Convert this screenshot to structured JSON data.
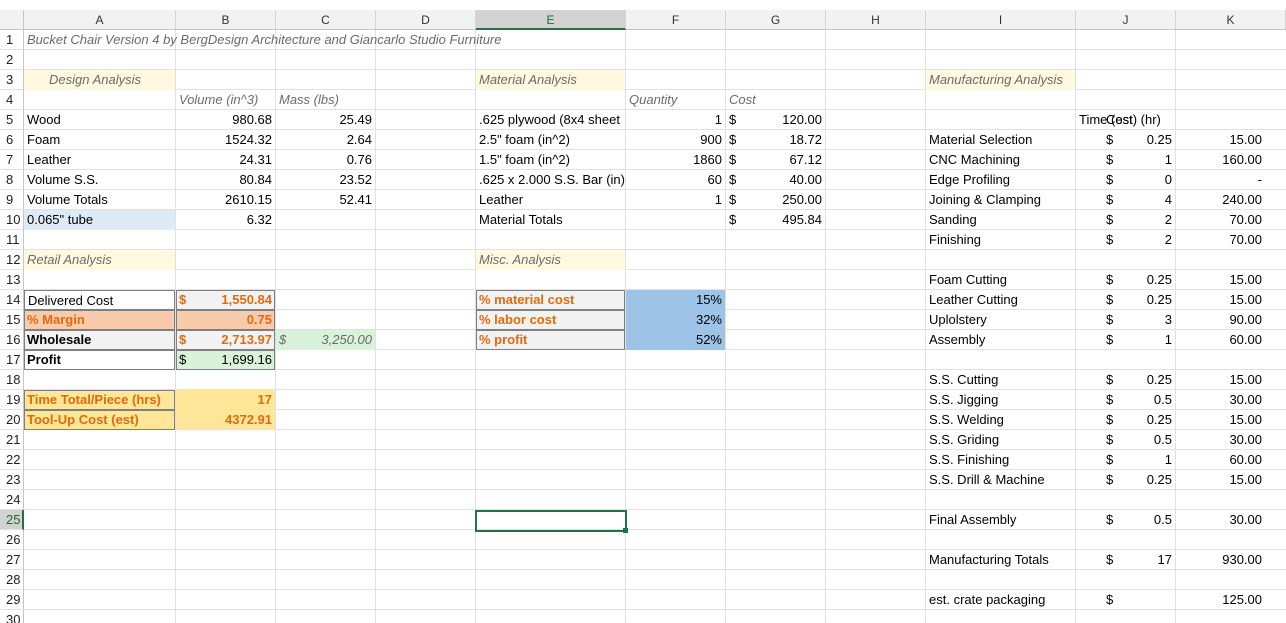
{
  "columns": [
    "A",
    "B",
    "C",
    "D",
    "E",
    "F",
    "G",
    "H",
    "I",
    "J",
    "K"
  ],
  "rows": [
    "1",
    "2",
    "3",
    "4",
    "5",
    "6",
    "7",
    "8",
    "9",
    "10",
    "11",
    "12",
    "13",
    "14",
    "15",
    "16",
    "17",
    "18",
    "19",
    "20",
    "21",
    "22",
    "23",
    "24",
    "25",
    "26",
    "27",
    "28",
    "29",
    "30"
  ],
  "selected_column": "E",
  "selected_row": "25",
  "title": "Bucket Chair Version 4 by BergDesign Architecture and Giancarlo Studio Furniture",
  "design": {
    "header": "Design Analysis",
    "col_volume": "Volume (in^3)",
    "col_mass": "Mass (lbs)",
    "rows": [
      {
        "label": "Wood",
        "volume": "980.68",
        "mass": "25.49"
      },
      {
        "label": "Foam",
        "volume": "1524.32",
        "mass": "2.64"
      },
      {
        "label": "Leather",
        "volume": "24.31",
        "mass": "0.76"
      },
      {
        "label": "Volume S.S.",
        "volume": "80.84",
        "mass": "23.52"
      },
      {
        "label": "Volume Totals",
        "volume": "2610.15",
        "mass": "52.41"
      },
      {
        "label": "0.065\" tube",
        "volume": "6.32",
        "mass": ""
      }
    ]
  },
  "material": {
    "header": "Material Analysis",
    "col_quantity": "Quantity",
    "col_cost": "Cost",
    "rows": [
      {
        "label": ".625 plywood (8x4 sheet",
        "qty": "1",
        "cur": "$",
        "cost": "120.00"
      },
      {
        "label": "2.5\" foam (in^2)",
        "qty": "900",
        "cur": "$",
        "cost": "18.72"
      },
      {
        "label": "1.5\" foam (in^2)",
        "qty": "1860",
        "cur": "$",
        "cost": "67.12"
      },
      {
        "label": ".625 x 2.000 S.S. Bar (in)",
        "qty": "60",
        "cur": "$",
        "cost": "40.00"
      },
      {
        "label": "Leather",
        "qty": "1",
        "cur": "$",
        "cost": "250.00"
      },
      {
        "label": "Material Totals",
        "qty": "",
        "cur": "$",
        "cost": "495.84"
      }
    ]
  },
  "retail": {
    "header": "Retail Analysis",
    "delivered_label": "Delivered Cost",
    "delivered_cur": "$",
    "delivered_value": "1,550.84",
    "margin_label": "% Margin",
    "margin_value": "0.75",
    "wholesale_label": "Wholesale",
    "wholesale_cur": "$",
    "wholesale_value": "2,713.97",
    "wholesale_alt_cur": "$",
    "wholesale_alt_value": "3,250.00",
    "profit_label": "Profit",
    "profit_cur": "$",
    "profit_value": "1,699.16",
    "time_label": "Time Total/Piece (hrs)",
    "time_value": "17",
    "toolup_label": "Tool-Up Cost (est)",
    "toolup_value": "4372.91"
  },
  "misc": {
    "header": "Misc. Analysis",
    "rows": [
      {
        "label": "% material cost",
        "value": "15%"
      },
      {
        "label": "% labor cost",
        "value": "32%"
      },
      {
        "label": "% profit",
        "value": "52%"
      }
    ]
  },
  "manufacturing": {
    "header": "Manufacturing Analysis",
    "col_time": "Time (est) (hr)",
    "col_cost": "Cost",
    "rows": [
      {
        "row": 6,
        "label": "Material Selection",
        "time": "0.25",
        "cur": "$",
        "cost": "15.00"
      },
      {
        "row": 7,
        "label": "CNC Machining",
        "time": "1",
        "cur": "$",
        "cost": "160.00"
      },
      {
        "row": 8,
        "label": "Edge Profiling",
        "time": "0",
        "cur": "$",
        "cost": "-"
      },
      {
        "row": 9,
        "label": "Joining & Clamping",
        "time": "4",
        "cur": "$",
        "cost": "240.00"
      },
      {
        "row": 10,
        "label": "Sanding",
        "time": "2",
        "cur": "$",
        "cost": "70.00"
      },
      {
        "row": 11,
        "label": "Finishing",
        "time": "2",
        "cur": "$",
        "cost": "70.00"
      },
      {
        "row": 13,
        "label": "Foam Cutting",
        "time": "0.25",
        "cur": "$",
        "cost": "15.00"
      },
      {
        "row": 14,
        "label": "Leather Cutting",
        "time": "0.25",
        "cur": "$",
        "cost": "15.00"
      },
      {
        "row": 15,
        "label": "Uplolstery",
        "time": "3",
        "cur": "$",
        "cost": "90.00"
      },
      {
        "row": 16,
        "label": "Assembly",
        "time": "1",
        "cur": "$",
        "cost": "60.00"
      },
      {
        "row": 18,
        "label": "S.S. Cutting",
        "time": "0.25",
        "cur": "$",
        "cost": "15.00"
      },
      {
        "row": 19,
        "label": "S.S. Jigging",
        "time": "0.5",
        "cur": "$",
        "cost": "30.00"
      },
      {
        "row": 20,
        "label": "S.S. Welding",
        "time": "0.25",
        "cur": "$",
        "cost": "15.00"
      },
      {
        "row": 21,
        "label": "S.S. Griding",
        "time": "0.5",
        "cur": "$",
        "cost": "30.00"
      },
      {
        "row": 22,
        "label": "S.S. Finishing",
        "time": "1",
        "cur": "$",
        "cost": "60.00"
      },
      {
        "row": 23,
        "label": "S.S. Drill & Machine",
        "time": "0.25",
        "cur": "$",
        "cost": "15.00"
      },
      {
        "row": 25,
        "label": "Final Assembly",
        "time": "0.5",
        "cur": "$",
        "cost": "30.00"
      },
      {
        "row": 27,
        "label": "Manufacturing Totals",
        "time": "17",
        "cur": "$",
        "cost": "930.00"
      },
      {
        "row": 29,
        "label": "est. crate packaging",
        "time": "",
        "cur": "$",
        "cost": "125.00"
      }
    ]
  }
}
